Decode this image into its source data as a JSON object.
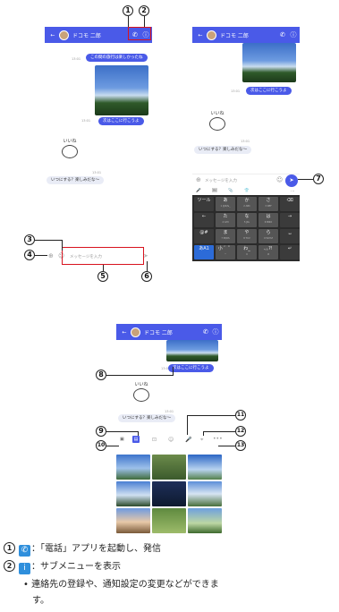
{
  "header": {
    "back": "←",
    "contact_name": "ドコモ 二郎",
    "call_icon": "phone-icon",
    "info_icon": "info-icon"
  },
  "messages": {
    "m1": "この間の旅行は楽しかったね",
    "m2": "次はここに行こうよ",
    "m3": "いつにする？楽しみだな〜",
    "read_time": "13:01",
    "read_label": "既読"
  },
  "stamp": {
    "label": "いいね"
  },
  "input": {
    "placeholder": "メッセージを入力",
    "attach_icon": "plus-icon",
    "emoji_icon": "smile-icon",
    "send_icon": "send-icon"
  },
  "keyboard": {
    "toolbar": [
      "🎤",
      "🖼",
      "📎",
      "👕",
      "…"
    ],
    "rows": [
      [
        {
          "l": "ツール",
          "s": ""
        },
        {
          "l": "あ",
          "s": "1 @#/&_"
        },
        {
          "l": "か",
          "s": "2 ABC"
        },
        {
          "l": "さ",
          "s": "3 DEF"
        },
        {
          "l": "⌫",
          "s": ""
        }
      ],
      [
        {
          "l": "←",
          "s": ""
        },
        {
          "l": "た",
          "s": "4 GHI"
        },
        {
          "l": "な",
          "s": "5 JKL"
        },
        {
          "l": "は",
          "s": "6 MNO"
        },
        {
          "l": "→",
          "s": ""
        }
      ],
      [
        {
          "l": "@#",
          "s": ""
        },
        {
          "l": "ま",
          "s": "7 PQRS"
        },
        {
          "l": "や",
          "s": "8 TUV"
        },
        {
          "l": "ら",
          "s": "9 WXYZ"
        },
        {
          "l": "␣",
          "s": ""
        }
      ],
      [
        {
          "l": "あA1",
          "s": ""
        },
        {
          "l": "小 ゛゜",
          "s": "*"
        },
        {
          "l": "わ_",
          "s": "0"
        },
        {
          "l": "､｡?!",
          "s": "#"
        },
        {
          "l": "↵",
          "s": ""
        }
      ]
    ]
  },
  "callouts": [
    "1",
    "2",
    "3",
    "4",
    "5",
    "6",
    "7",
    "8",
    "9",
    "10",
    "11",
    "12",
    "13"
  ],
  "attach_bar": {
    "gallery_icon": "gallery-icon",
    "camera_icon": "camera-icon",
    "stamp_icon": "stamp-icon",
    "mic_icon": "mic-icon",
    "location_icon": "location-icon",
    "more_icon": "more-icon"
  },
  "legend": {
    "item1": "：「電話」アプリを起動し、発信",
    "item2": "：サブメニューを表示",
    "bullet": "•",
    "sub1": "連絡先の登録や、通知設定の変更などができま",
    "sub2": "す。"
  }
}
